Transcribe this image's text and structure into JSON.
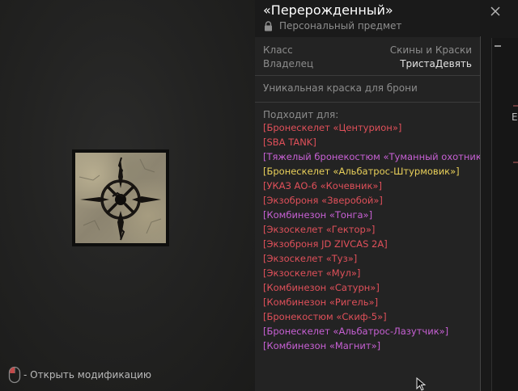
{
  "left": {
    "item_icon": "compass-crack-paint-icon",
    "hint_icon": "mouse-icon",
    "hint_text": "- Открыть модификацию"
  },
  "panel": {
    "title": "«Перерожденный»",
    "subtitle_icon": "lock-icon",
    "subtitle": "Персональный предмет",
    "meta": [
      {
        "key": "Класс",
        "value": "Скины и Краски"
      },
      {
        "key": "Владелец",
        "value": "ТристаДевять"
      }
    ],
    "description": "Уникальная краска для брони",
    "compat_title": "Подходит для:",
    "compat_items": [
      {
        "label": "[Бронескелет «Центурион»]",
        "color": "#e0505a"
      },
      {
        "label": "[SBA TANK]",
        "color": "#e0505a"
      },
      {
        "label": "[Тяжелый бронекостюм «Туманный охотник»]",
        "color": "#c760d4"
      },
      {
        "label": "[Бронескелет «Альбатрос-Штурмовик»]",
        "color": "#e9d05a"
      },
      {
        "label": "[УКАЗ АО-6 «Кочевник»]",
        "color": "#e0505a"
      },
      {
        "label": "[Экзоброня «Зверобой»]",
        "color": "#e0505a"
      },
      {
        "label": "[Комбинезон «Тонга»]",
        "color": "#c760d4"
      },
      {
        "label": "[Экзоскелет «Гектор»]",
        "color": "#e0505a"
      },
      {
        "label": "[Экзоброня JD ZIVCAS 2A]",
        "color": "#e0505a"
      },
      {
        "label": "[Экзоскелет «Туз»]",
        "color": "#e0505a"
      },
      {
        "label": "[Экзоскелет «Мул»]",
        "color": "#e0505a"
      },
      {
        "label": "[Комбинезон «Сатурн»]",
        "color": "#e0505a"
      },
      {
        "label": "[Комбинезон «Ригель»]",
        "color": "#e0505a"
      },
      {
        "label": "[Бронекостюм «Скиф-5»]",
        "color": "#e0505a"
      },
      {
        "label": "[Бронескелет «Альбатрос-Лазутчик»]",
        "color": "#c760d4"
      },
      {
        "label": "[Комбинезон «Магнит»]",
        "color": "#c760d4"
      }
    ]
  },
  "edge": {
    "close_icon": "close-icon",
    "collapse_icon": "minus-icon",
    "fragment": "Ex"
  },
  "colors": {
    "red_rarity": "#e0505a",
    "purple_rarity": "#c760d4",
    "gold_rarity": "#e9d05a"
  }
}
